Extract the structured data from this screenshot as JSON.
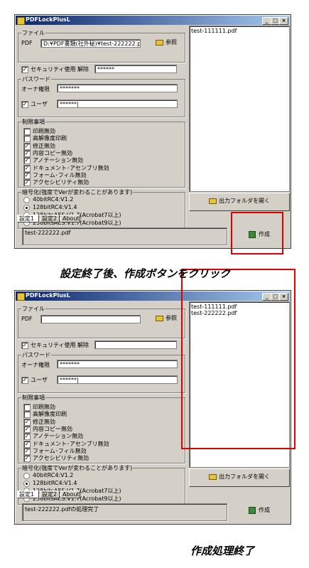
{
  "app_title": "PDFLockPlusL",
  "window_buttons": {
    "min": "_",
    "max": "□",
    "close": "×"
  },
  "panels": [
    {
      "file_group": "ファイル",
      "pdf_label": "PDF",
      "pdf_value": "D:¥PDF書類(社外秘)¥test-222222.pdf",
      "browse_label": "参照",
      "security_label": "セキュリティ使用",
      "security_checked": true,
      "release_label": "解除",
      "release_value": "******",
      "password_group": "パスワード",
      "owner_label": "オーナ権限",
      "owner_value": "*******",
      "user_label": "ユーザ",
      "user_checked": true,
      "user_value": "******|",
      "restrictions_group": "制限事項",
      "restrictions": [
        {
          "label": "印刷無効",
          "checked": false
        },
        {
          "label": "高解像度印刷",
          "checked": false
        },
        {
          "label": "修正無効",
          "checked": true
        },
        {
          "label": "内容コピー無効",
          "checked": true
        },
        {
          "label": "アノテーション無効",
          "checked": true
        },
        {
          "label": "ドキュメント･アセンブリ無効",
          "checked": true
        },
        {
          "label": "フォーム･フィル無効",
          "checked": true
        },
        {
          "label": "アクセシビリティ無効",
          "checked": true
        }
      ],
      "encryption_group": "暗号化(強度でVerが変わることがあります)",
      "encryption": [
        {
          "label": "40bitRC4:V1.2",
          "selected": false
        },
        {
          "label": "128bitRC4:V1.4",
          "selected": true
        },
        {
          "label": "128bitsAES:V1.7(Acrobat7以上)",
          "selected": false
        },
        {
          "label": "256bitsAES:V1.7(Acrobat9以上)",
          "selected": false
        }
      ],
      "tabs": [
        "設定1",
        "設定2",
        "About"
      ],
      "list": [
        "test-111111.pdf"
      ],
      "open_folder_label": "出力フォルダを開く",
      "status_text": "test-222222.pdf",
      "create_label": "作成"
    },
    {
      "file_group": "ファイル",
      "pdf_label": "PDF",
      "pdf_value": "",
      "browse_label": "参照",
      "security_label": "セキュリティ使用",
      "security_checked": true,
      "release_label": "解除",
      "release_value": "",
      "password_group": "パスワード",
      "owner_label": "オーナ権限",
      "owner_value": "*******",
      "user_label": "ユーザ",
      "user_checked": true,
      "user_value": "******|",
      "restrictions_group": "制限事項",
      "restrictions": [
        {
          "label": "印刷無効",
          "checked": false
        },
        {
          "label": "高解像度印刷",
          "checked": false
        },
        {
          "label": "修正無効",
          "checked": true
        },
        {
          "label": "内容コピー無効",
          "checked": true
        },
        {
          "label": "アノテーション無効",
          "checked": true
        },
        {
          "label": "ドキュメント･アセンブリ無効",
          "checked": true
        },
        {
          "label": "フォーム･フィル無効",
          "checked": true
        },
        {
          "label": "アクセシビリティ無効",
          "checked": true
        }
      ],
      "encryption_group": "暗号化(強度でVerが変わることがあります)",
      "encryption": [
        {
          "label": "40bitRC4:V1.2",
          "selected": false
        },
        {
          "label": "128bitRC4:V1.4",
          "selected": true
        },
        {
          "label": "128bitsAES:V1.7(Acrobat7以上)",
          "selected": false
        },
        {
          "label": "256bitsAES:V1.7(Acrobat9以上)",
          "selected": false
        }
      ],
      "tabs": [
        "設定1",
        "設定2",
        "About"
      ],
      "list": [
        "test-111111.pdf",
        "test-222222.pdf"
      ],
      "open_folder_label": "出力フォルダを開く",
      "status_text": "test-222222.pdfの処理完了",
      "create_label": "作成"
    }
  ],
  "captions": {
    "step1": "設定終了後、作成ボタンをクリック",
    "step2": "作成処理終了"
  },
  "highlight_color": "#e00000"
}
